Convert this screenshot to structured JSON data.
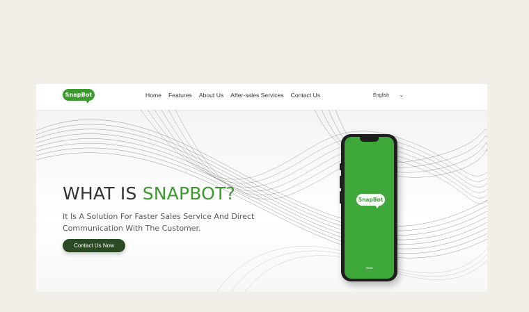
{
  "brand": {
    "logo_text": "SnapBot"
  },
  "nav": {
    "items": [
      {
        "label": "Home"
      },
      {
        "label": "Features"
      },
      {
        "label": "About Us"
      },
      {
        "label": "After-sales Services"
      },
      {
        "label": "Contact Us"
      }
    ],
    "language": {
      "selected": "English",
      "icon": "chevron-down-icon"
    }
  },
  "hero": {
    "title_prefix": "WHAT IS ",
    "title_accent": "SNAPBOT?",
    "subtitle": "It Is A Solution For Faster Sales Service And Direct Communication With The Customer.",
    "cta_label": "Contact Us Now"
  },
  "phone": {
    "screen_logo": "SnapBot",
    "screen_footer": "2022"
  },
  "colors": {
    "accent": "#3d9a2e",
    "cta": "#2b4a24",
    "background": "#f2efe9",
    "phone_screen": "#3fa83a"
  }
}
